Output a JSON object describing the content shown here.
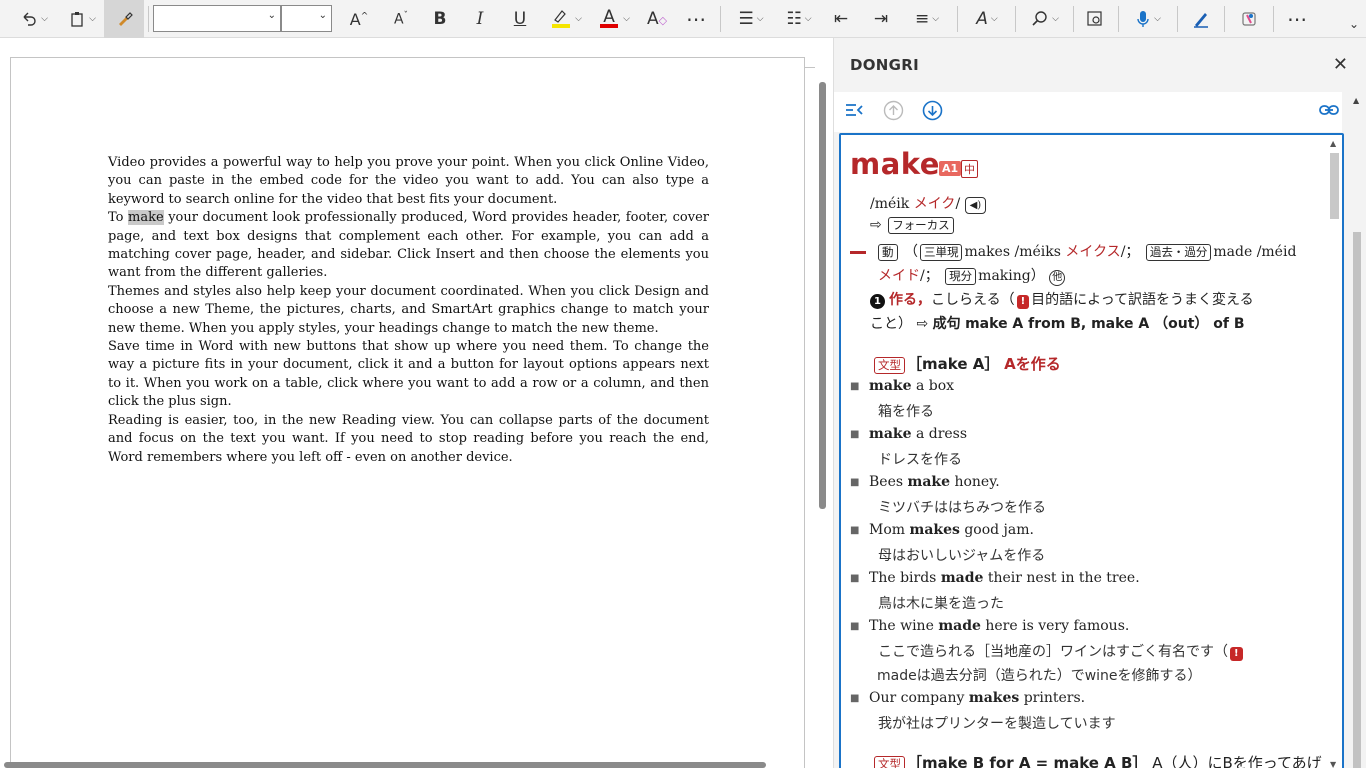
{
  "toolbar": {
    "font_name": "",
    "font_size": ""
  },
  "document": {
    "paragraphs": [
      {
        "before": "Video provides a powerful way to help you prove your point. When you click Online Video, you can paste in the embed code for the video you want to add. You can also type a keyword to search online for the video that best fits your document.",
        "highlight": "",
        "after": ""
      },
      {
        "before": "To ",
        "highlight": "make",
        "after": " your document look professionally produced, Word provides header, footer, cover page, and text box designs that complement each other. For example, you can add a matching cover page, header, and sidebar. Click Insert and then choose the elements you want from the different galleries."
      },
      {
        "before": "Themes and styles also help keep your document coordinated. When you click Design and choose a new Theme, the pictures, charts, and SmartArt graphics change to match your new theme. When you apply styles, your headings change to match the new theme.",
        "highlight": "",
        "after": ""
      },
      {
        "before": "Save time in Word with new buttons that show up where you need them. To change the way a picture fits in your document, click it and a button for layout options appears next to it. When you work on a table, click where you want to add a row or a column, and then click the plus sign.",
        "highlight": "",
        "after": ""
      },
      {
        "before": "Reading is easier, too, in the new Reading view. You can collapse parts of the document and focus on the text you want. If you need to stop reading before you reach the end, Word remembers where you left off - even on another device.",
        "highlight": "",
        "after": ""
      }
    ]
  },
  "pane": {
    "title": "DONGRI",
    "close": "✕"
  },
  "entry": {
    "headword": "make",
    "level": "A1",
    "level2": "中",
    "pron_ipa": "/méik",
    "pron_kana": "メイク",
    "pron_end": "/",
    "ref_arrow": "⇨",
    "ref_box": "フォーカス",
    "pos": "動",
    "paren_open": "（",
    "form1_label": "三単現",
    "form1_word": "makes",
    "form1_ipa": "/méiks",
    "form1_kana": "メイクス",
    "form1_end": "/；",
    "form2_label": "過去・過分",
    "form2_word": "made",
    "form2_ipa": "/méid",
    "form2_kana": "メイド",
    "form2_end": "/；",
    "form3_label": "現分",
    "form3_word": "making",
    "paren_close": "）",
    "other_mark": "他",
    "sense_num": "1",
    "sense_main": "作る，",
    "sense_rest": "こしらえる（",
    "sense_note": "目的語によって訳語をうまく変える",
    "sense_line2_a": "こと）",
    "sense_arrow": "⇨",
    "sense_line2_b": "成句",
    "sense_phrase": "make A from B, make A （out） of B",
    "pattern1_label": "文型",
    "pattern1_text": "［make A］",
    "pattern1_mean": "Aを作る",
    "examples": [
      {
        "en_pre": "",
        "en_bold": "make",
        "en_post": " a box",
        "ja": "箱を作る"
      },
      {
        "en_pre": "",
        "en_bold": "make",
        "en_post": " a dress",
        "ja": "ドレスを作る"
      },
      {
        "en_pre": "Bees ",
        "en_bold": "make",
        "en_post": " honey.",
        "ja": "ミツバチははちみつを作る"
      },
      {
        "en_pre": "Mom ",
        "en_bold": "makes",
        "en_post": " good jam.",
        "ja": "母はおいしいジャムを作る"
      },
      {
        "en_pre": "The birds ",
        "en_bold": "made",
        "en_post": " their nest in the tree.",
        "ja": "鳥は木に巣を造った"
      },
      {
        "en_pre": "The wine ",
        "en_bold": "made",
        "en_post": " here is very famous.",
        "ja": "ここで造られる［当地産の］ワインはすごく有名です（"
      },
      {
        "en_pre": "Our company ",
        "en_bold": "makes",
        "en_post": " printers.",
        "ja": "我が社はプリンターを製造しています"
      }
    ],
    "wine_note": "madeは過去分詞（造られた）でwineを修飾する）",
    "pattern2_label": "文型",
    "pattern2_text": "［make B for A = make A B］",
    "pattern2_mean": "A（人）にBを作ってあげ"
  },
  "icons": {
    "accent": "#1a73c8",
    "red": "#b5282a"
  }
}
